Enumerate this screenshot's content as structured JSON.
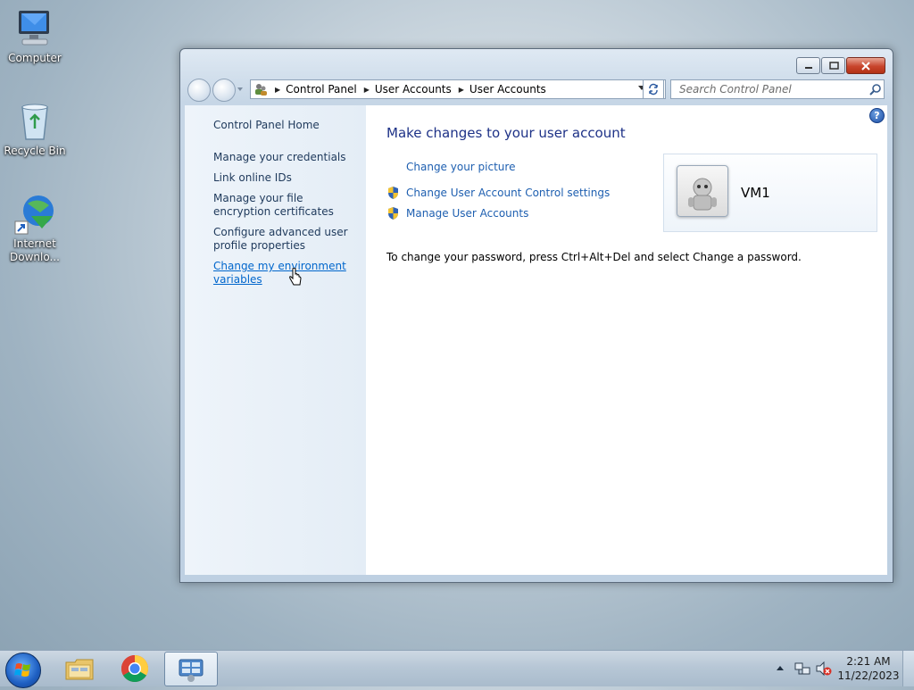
{
  "desktop": {
    "icons": [
      {
        "label": "Computer"
      },
      {
        "label": "Recycle Bin"
      },
      {
        "label": "Internet Downlo..."
      }
    ]
  },
  "window": {
    "breadcrumb": [
      "Control Panel",
      "User Accounts",
      "User Accounts"
    ],
    "search_placeholder": "Search Control Panel",
    "left_nav": {
      "home": "Control Panel Home",
      "items": [
        "Manage your credentials",
        "Link online IDs",
        "Manage your file encryption certificates",
        "Configure advanced user profile properties",
        "Change my environment variables"
      ]
    },
    "heading": "Make changes to your user account",
    "tasks": [
      {
        "label": "Change your picture",
        "icon": "none"
      },
      {
        "label": "Change User Account Control settings",
        "icon": "uac-shield-icon"
      },
      {
        "label": "Manage User Accounts",
        "icon": "uac-shield-icon"
      }
    ],
    "user": {
      "name": "VM1"
    },
    "password_note": "To change your password, press Ctrl+Alt+Del and select Change a password."
  },
  "taskbar": {
    "clock_time": "2:21 AM",
    "clock_date": "11/22/2023"
  },
  "colors": {
    "link": "#0066cc",
    "heading": "#1e3287",
    "left_pane_text": "#1e395b",
    "close_button": "#c8452c"
  }
}
